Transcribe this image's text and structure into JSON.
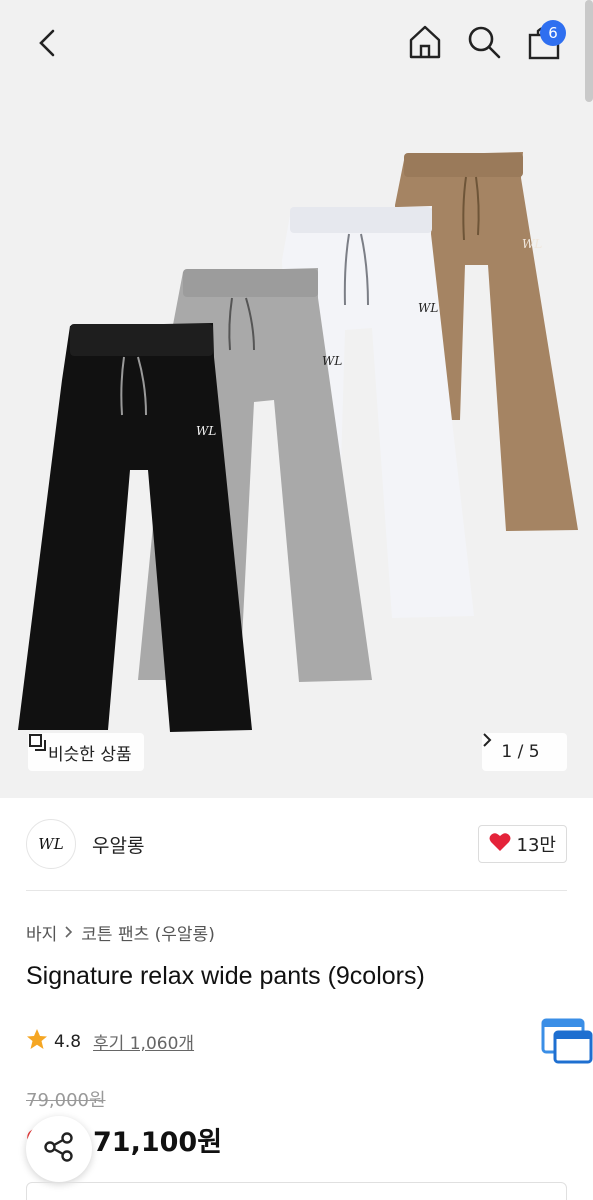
{
  "topbar": {
    "cart_count": "6",
    "icons": [
      "back-arrow",
      "home",
      "search",
      "shopping-bag"
    ]
  },
  "gallery": {
    "similar_label": "비슷한 상품",
    "counter": "1 / 5",
    "pants_colors": [
      "#111111",
      "#a9a9a9",
      "#f3f4f8",
      "#a58463"
    ],
    "emblem": "WL"
  },
  "brand": {
    "logo_text": "WL",
    "name": "우알롱",
    "likes": "13만"
  },
  "breadcrumb": {
    "category": "바지",
    "subcategory": "코튼 팬츠 (우알롱)"
  },
  "product": {
    "title": "Signature relax wide pants (9colors)",
    "rating": "4.8",
    "reviews": "후기 1,060개",
    "original_price": "79,000원",
    "sale_price": "71,100원"
  },
  "colors": {
    "accent_blue": "#2f6ff0",
    "star": "#f5a623",
    "heart": "#e4233a",
    "sale_red": "#e73a3a"
  }
}
